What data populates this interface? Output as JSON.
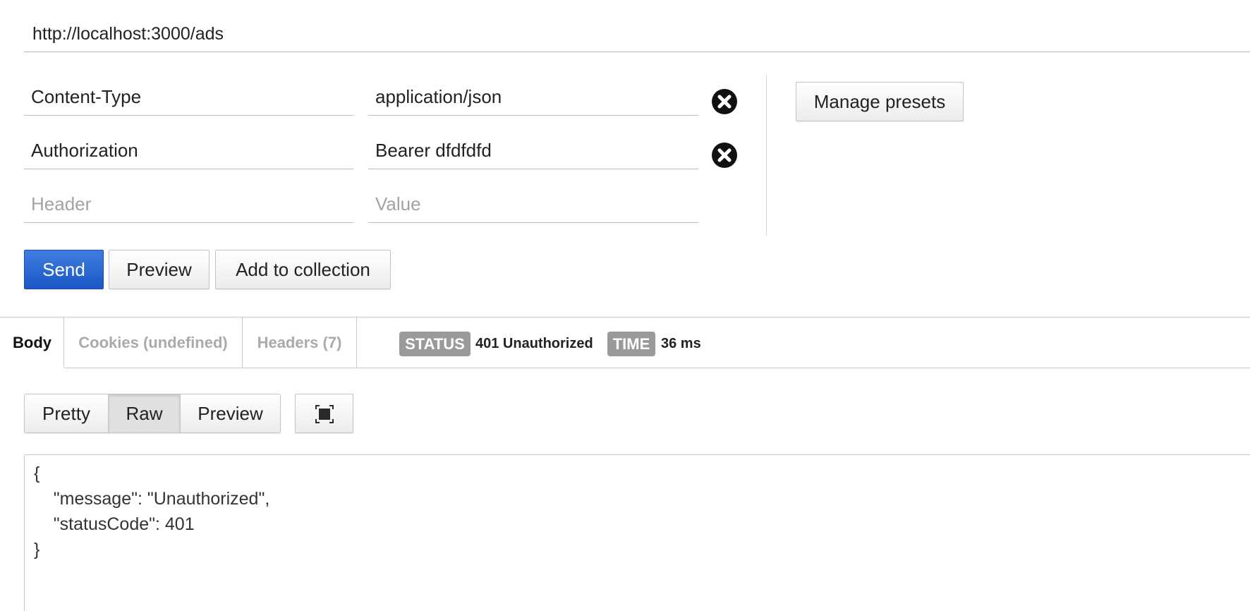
{
  "request": {
    "url": "http://localhost:3000/ads",
    "headers": [
      {
        "name": "Content-Type",
        "value": "application/json"
      },
      {
        "name": "Authorization",
        "value": "Bearer dfdfdfd"
      }
    ],
    "new_header_placeholder": "Header",
    "new_value_placeholder": "Value",
    "manage_presets_label": "Manage presets",
    "send_label": "Send",
    "preview_label": "Preview",
    "add_to_collection_label": "Add to collection"
  },
  "response": {
    "tabs": [
      {
        "label": "Body",
        "active": true
      },
      {
        "label": "Cookies (undefined)",
        "active": false
      },
      {
        "label": "Headers (7)",
        "active": false
      }
    ],
    "status_label": "STATUS",
    "status_value": "401 Unauthorized",
    "time_label": "TIME",
    "time_value": "36 ms",
    "view_modes": [
      {
        "label": "Pretty",
        "active": false
      },
      {
        "label": "Raw",
        "active": true
      },
      {
        "label": "Preview",
        "active": false
      }
    ],
    "expand_icon": "fullscreen-icon",
    "body_lines": [
      "{",
      "    \"message\": \"Unauthorized\",",
      "    \"statusCode\": 401",
      "}"
    ]
  },
  "colors": {
    "primary_button": "#1b56c6",
    "badge_background": "#9a9a9a",
    "remove_icon": "#111111"
  }
}
